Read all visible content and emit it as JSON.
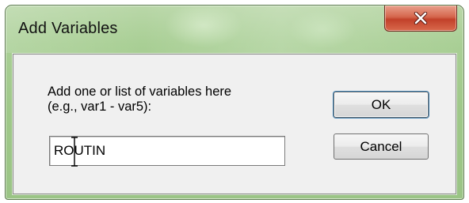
{
  "dialog": {
    "title": "Add Variables",
    "close_icon": "close-x-icon",
    "prompt_line1": "Add one or list of variables here",
    "prompt_line2": "(e.g., var1 - var5):",
    "input_value": "ROUTIN",
    "ok_label": "OK",
    "cancel_label": "Cancel"
  },
  "colors": {
    "titlebar": "#a9cf95",
    "close_button": "#c2412a",
    "client_bg": "#f0f0f0"
  }
}
